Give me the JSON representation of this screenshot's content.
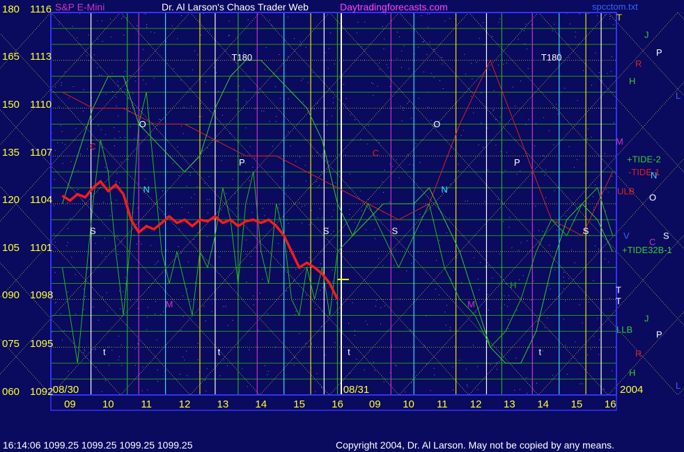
{
  "header": {
    "symbol": "S&P E-Mini",
    "title": "Dr. Al Larson's Chaos Trader Web",
    "site": "Daytradingforecasts.com",
    "file": "spcctom.txt"
  },
  "colors": {
    "background": "#0a0a5e",
    "plot_border": "#3333ff",
    "grid_yellow": "#e6e600",
    "grid_green": "#22aa22",
    "price_red": "#ff1a1a",
    "tide2_green": "#33cc33",
    "tide1_red": "#dd2222",
    "marker_white": "#ffffff",
    "marker_cyan": "#33ddff",
    "marker_magenta": "#cc33cc",
    "label_yellow": "#ffff33"
  },
  "footer": {
    "quote": "16:14:06  1099.25 1099.25 1099.25 1099.25",
    "copyright": "Copyright 2004, Dr. Al Larson. May not be copied by any means."
  },
  "chart_data": {
    "type": "line",
    "title": "S&P E-Mini",
    "y_left_labels": [
      "180",
      "165",
      "150",
      "135",
      "120",
      "105",
      "090",
      "075",
      "060"
    ],
    "y_right_labels": [
      "1116",
      "1113",
      "1110",
      "1107",
      "1104",
      "1101",
      "1098",
      "1095",
      "1092"
    ],
    "ylim": [
      1092,
      1116
    ],
    "day_labels": [
      "08/30",
      "08/31",
      "2004"
    ],
    "hour_ticks": [
      "09",
      "10",
      "11",
      "12",
      "13",
      "14",
      "15",
      "16",
      "09",
      "10",
      "11",
      "12",
      "13",
      "14",
      "15",
      "16"
    ],
    "series": [
      {
        "name": "+TIDE-2",
        "x": [
          8.8,
          9.2,
          9.6,
          10.0,
          10.4,
          10.8,
          11.2,
          11.6,
          12.0,
          12.4,
          12.8,
          13.2,
          13.6,
          14.0,
          14.4,
          14.8,
          15.2,
          15.6,
          16.0,
          16.4,
          16.8,
          17.2,
          17.6,
          18.0,
          18.4,
          18.8,
          19.2,
          19.6,
          20.0,
          20.4,
          20.8,
          21.2,
          21.6,
          22.0,
          22.4,
          22.8,
          23.2
        ],
        "y": [
          1104,
          1107,
          1110,
          1112,
          1112,
          1109,
          1108,
          1107,
          1106,
          1107,
          1110,
          1112,
          1113,
          1113,
          1112,
          1111,
          1110,
          1108,
          1104,
          1102,
          1103,
          1104,
          1104,
          1104,
          1105,
          1103,
          1101,
          1098,
          1095,
          1094,
          1094,
          1096,
          1100,
          1103,
          1104,
          1103,
          1101
        ]
      },
      {
        "name": "-TIDE-1",
        "x": [
          8.8,
          9.6,
          10.4,
          11.2,
          12.0,
          12.8,
          13.6,
          14.4,
          15.2,
          16.0,
          16.8,
          17.6,
          18.4,
          19.2,
          20.0,
          20.8,
          21.6,
          22.4,
          23.2
        ],
        "y": [
          1111,
          1110,
          1110,
          1109,
          1109,
          1108,
          1107,
          1107,
          1106,
          1105,
          1104,
          1103,
          1104,
          1109,
          1113,
          1108,
          1103,
          1102,
          1106
        ]
      },
      {
        "name": "+TIDE32B-1",
        "x": [
          8.8,
          9.0,
          9.2,
          9.4,
          9.6,
          9.8,
          10.0,
          10.2,
          10.4,
          10.6,
          10.8,
          11.0,
          11.2,
          11.4,
          11.6,
          11.8,
          12.0,
          12.2,
          12.4,
          12.6,
          12.8,
          13.0,
          13.2,
          13.4,
          13.6,
          13.8,
          14.0,
          14.2,
          14.4,
          14.6,
          14.8,
          15.0,
          15.2,
          15.4,
          15.6,
          15.8,
          16.0,
          16.4,
          16.8,
          17.2,
          17.6,
          18.0,
          18.4,
          18.8,
          19.2,
          19.6,
          20.0,
          20.4,
          20.8,
          21.2,
          21.6,
          22.0,
          22.4,
          22.8,
          23.2
        ],
        "y": [
          1100,
          1097,
          1094,
          1099,
          1104,
          1108,
          1106,
          1101,
          1097,
          1102,
          1109,
          1111,
          1106,
          1101,
          1099,
          1101,
          1099,
          1097,
          1101,
          1100,
          1102,
          1105,
          1103,
          1099,
          1104,
          1106,
          1101,
          1099,
          1104,
          1102,
          1098,
          1097,
          1100,
          1098,
          1100,
          1097,
          1101,
          1102,
          1104,
          1102,
          1100,
          1102,
          1104,
          1100,
          1098,
          1097,
          1095,
          1096,
          1098,
          1101,
          1103,
          1102,
          1104,
          1105,
          1102
        ]
      },
      {
        "name": "price",
        "x": [
          8.8,
          9.0,
          9.2,
          9.4,
          9.6,
          9.8,
          10.0,
          10.2,
          10.4,
          10.6,
          10.8,
          11.0,
          11.2,
          11.4,
          11.6,
          11.8,
          12.0,
          12.2,
          12.4,
          12.6,
          12.8,
          13.0,
          13.2,
          13.4,
          13.6,
          13.8,
          14.0,
          14.2,
          14.4,
          14.6,
          14.8,
          15.0,
          15.2,
          15.4,
          15.6,
          15.8,
          16.0
        ],
        "y": [
          1104.5,
          1104.2,
          1104.6,
          1104.4,
          1105.0,
          1105.4,
          1104.8,
          1105.2,
          1104.6,
          1103.0,
          1102.2,
          1102.6,
          1102.4,
          1102.8,
          1103.2,
          1102.8,
          1103.0,
          1102.6,
          1103.0,
          1102.9,
          1103.2,
          1102.8,
          1103.0,
          1102.6,
          1102.9,
          1103.0,
          1102.8,
          1103.0,
          1102.6,
          1102.0,
          1101.0,
          1100.0,
          1100.3,
          1100.0,
          1099.6,
          1099.0,
          1098.0
        ]
      }
    ],
    "annotations": [
      "T180",
      "T180",
      "O",
      "O",
      "N",
      "N",
      "S",
      "S",
      "S",
      "S",
      "P",
      "P",
      "M",
      "M",
      "M",
      "C",
      "C",
      "H",
      "t",
      "t",
      "t",
      "t"
    ],
    "right_labels": [
      {
        "text": "T",
        "color": "#e6e600"
      },
      {
        "text": "J",
        "color": "#33cc33"
      },
      {
        "text": "P",
        "color": "#ffffff"
      },
      {
        "text": "R",
        "color": "#dd2222"
      },
      {
        "text": "H",
        "color": "#33cc33"
      },
      {
        "text": "L",
        "color": "#3366ff"
      },
      {
        "text": "M",
        "color": "#cc33cc"
      },
      {
        "text": "+TIDE-2",
        "color": "#33cc33"
      },
      {
        "text": "-TIDE-1",
        "color": "#dd2222"
      },
      {
        "text": "N",
        "color": "#33ddff"
      },
      {
        "text": "ULB",
        "color": "#dd2222"
      },
      {
        "text": "O",
        "color": "#ffffff"
      },
      {
        "text": "V",
        "color": "#3366ff"
      },
      {
        "text": "C",
        "color": "#cc33cc"
      },
      {
        "text": "S",
        "color": "#ffffff"
      },
      {
        "text": "+TIDE32B-1",
        "color": "#33cc33"
      },
      {
        "text": "T",
        "color": "#ffffff"
      },
      {
        "text": "T",
        "color": "#ffffff"
      },
      {
        "text": "J",
        "color": "#33cc33"
      },
      {
        "text": "LLB",
        "color": "#33cc33"
      },
      {
        "text": "P",
        "color": "#ffffff"
      },
      {
        "text": "R",
        "color": "#dd2222"
      },
      {
        "text": "H",
        "color": "#33cc33"
      },
      {
        "text": "L",
        "color": "#3366ff"
      }
    ]
  }
}
